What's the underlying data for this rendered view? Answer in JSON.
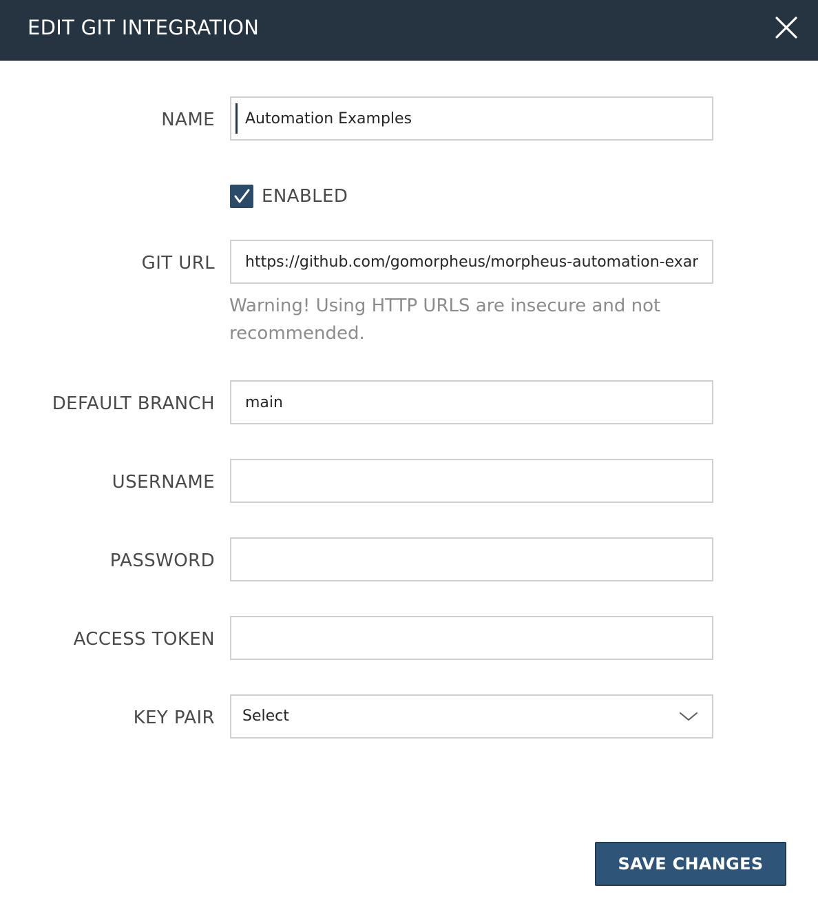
{
  "dialog": {
    "title": "EDIT GIT INTEGRATION",
    "close_icon": "close-icon"
  },
  "form": {
    "name": {
      "label": "NAME",
      "value": "Automation Examples"
    },
    "enabled": {
      "label": "ENABLED",
      "checked": true
    },
    "git_url": {
      "label": "GIT URL",
      "value": "https://github.com/gomorpheus/morpheus-automation-examples",
      "warning": "Warning! Using HTTP URLS are insecure and not recommended."
    },
    "default_branch": {
      "label": "DEFAULT BRANCH",
      "value": "main"
    },
    "username": {
      "label": "USERNAME",
      "value": ""
    },
    "password": {
      "label": "PASSWORD",
      "value": ""
    },
    "access_token": {
      "label": "ACCESS TOKEN",
      "value": ""
    },
    "key_pair": {
      "label": "KEY PAIR",
      "selected": "Select",
      "icon": "chevron-down-icon"
    }
  },
  "footer": {
    "save_label": "SAVE CHANGES"
  },
  "colors": {
    "header_bg": "#263442",
    "primary_button": "#2e5577",
    "checkbox": "#2b4b6b"
  }
}
